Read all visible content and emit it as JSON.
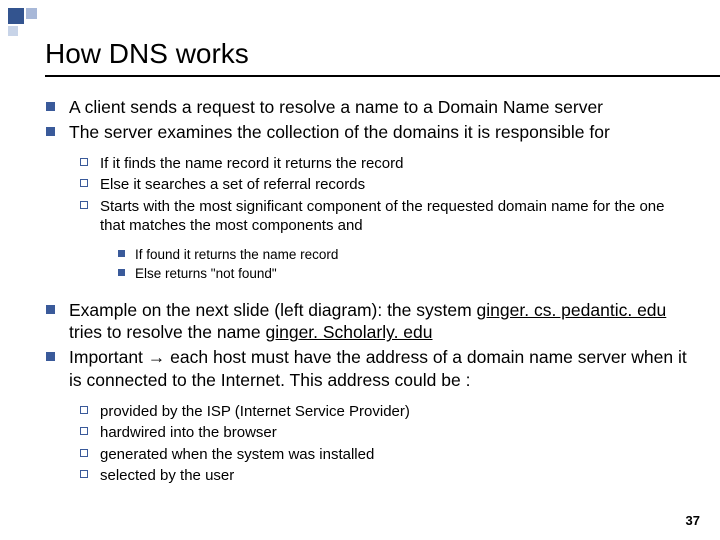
{
  "title": "How DNS works",
  "bullets": {
    "b1": "A client sends a request to resolve a name to a Domain Name server",
    "b2": "The server examines the collection of the domains it is responsible for",
    "b2_1": "If it finds the name record it returns the record",
    "b2_2": "Else it searches a set of referral records",
    "b2_3": "Starts with the most significant component of the requested domain name for the one that matches the most components  and",
    "b2_3_1": "If found it returns the name record",
    "b2_3_2": "Else  returns \"not found\"",
    "b3_pre": "Example on the next slide (left diagram): the system ",
    "b3_u1": "ginger. cs. pedantic. edu",
    "b3_mid": " tries to resolve the name ",
    "b3_u2": "ginger. Scholarly. edu",
    "b4_pre": "Important ",
    "b4_arrow": "→",
    "b4_post": " each host must have the address of a domain name server when it is connected to the Internet. This address could be :",
    "b4_1": "provided by  the ISP (Internet Service Provider)",
    "b4_2": "hardwired into the browser",
    "b4_3": "generated when the system was installed",
    "b4_4": "selected by the user"
  },
  "page_number": "37"
}
